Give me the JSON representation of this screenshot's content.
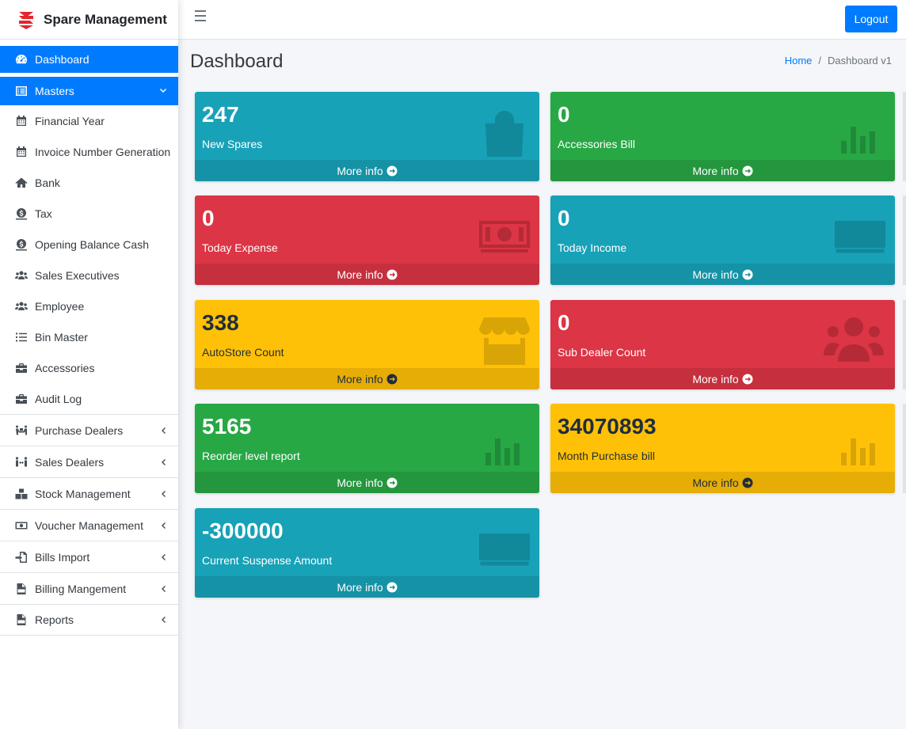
{
  "brand": {
    "title": "Spare Management",
    "logo_color": "#e3262d"
  },
  "sidebar": {
    "items": [
      {
        "label": "Dashboard",
        "icon": "tachometer-icon"
      },
      {
        "label": "Masters",
        "icon": "list-alt-icon"
      },
      {
        "label": "Financial Year",
        "icon": "calendar-icon"
      },
      {
        "label": "Invoice Number Generation",
        "icon": "calendar-icon"
      },
      {
        "label": "Bank",
        "icon": "home-icon"
      },
      {
        "label": "Tax",
        "icon": "money-coin-icon"
      },
      {
        "label": "Opening Balance Cash",
        "icon": "money-coin-icon"
      },
      {
        "label": "Sales Executives",
        "icon": "users-icon"
      },
      {
        "label": "Employee",
        "icon": "users-icon"
      },
      {
        "label": "Bin Master",
        "icon": "list-icon"
      },
      {
        "label": "Accessories",
        "icon": "toolbox-icon"
      },
      {
        "label": "Audit Log",
        "icon": "toolbox-icon"
      },
      {
        "label": "Purchase Dealers",
        "icon": "people-carry-icon"
      },
      {
        "label": "Sales Dealers",
        "icon": "people-arrows-icon"
      },
      {
        "label": "Stock Management",
        "icon": "boxes-icon"
      },
      {
        "label": "Voucher Management",
        "icon": "money-bill-icon"
      },
      {
        "label": "Bills Import",
        "icon": "file-import-icon"
      },
      {
        "label": "Billing Mangement",
        "icon": "file-csv-icon"
      },
      {
        "label": "Reports",
        "icon": "file-csv-icon"
      }
    ]
  },
  "header": {
    "logout_label": "Logout"
  },
  "main": {
    "title": "Dashboard",
    "breadcrumb": {
      "home": "Home",
      "sep": "/",
      "current": "Dashboard v1"
    },
    "more_info": "More info",
    "boxes": [
      {
        "value": "247",
        "label": "New Spares",
        "icon": "shopping-bag-icon",
        "color": "#17a2b8"
      },
      {
        "value": "0",
        "label": "Accessories Bill",
        "icon": "bar-chart-icon",
        "color": "#28a745"
      },
      {
        "value": "0",
        "label": "Today Expense",
        "icon": "money-bill-icon",
        "color": "#dc3545"
      },
      {
        "value": "0",
        "label": "Today Income",
        "icon": "money-bill-icon",
        "color": "#17a2b8"
      },
      {
        "value": "338",
        "label": "AutoStore Count",
        "icon": "store-icon",
        "color": "#ffc107"
      },
      {
        "value": "0",
        "label": "Sub Dealer Count",
        "icon": "users-icon",
        "color": "#dc3545"
      },
      {
        "value": "5165",
        "label": "Reorder level report",
        "icon": "bar-chart-icon",
        "color": "#28a745"
      },
      {
        "value": "34070893",
        "label": "Month Purchase bill",
        "icon": "bar-chart-icon",
        "color": "#ffc107"
      },
      {
        "value": "-300000",
        "label": "Current Suspense Amount",
        "icon": "money-bill-icon",
        "color": "#17a2b8"
      }
    ]
  }
}
